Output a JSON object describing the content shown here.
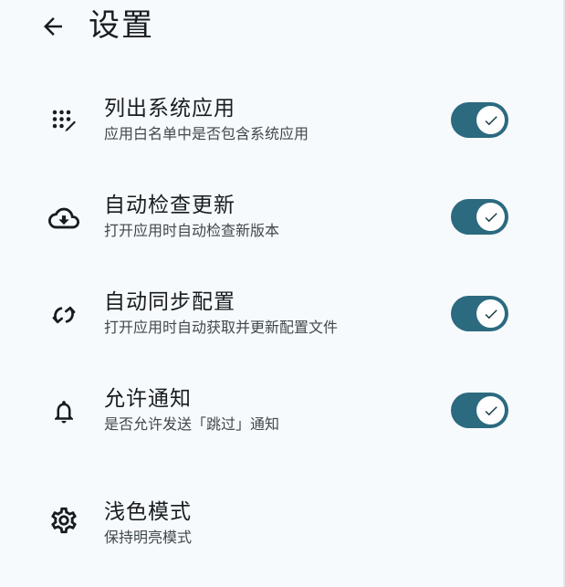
{
  "app_bar": {
    "title": "设置",
    "back_icon": "arrow-back-icon"
  },
  "colors": {
    "background": "#f7fafc",
    "switch_track_on": "#2b6a7f",
    "switch_thumb": "#ffffff",
    "primary_text": "#181c1f",
    "secondary_text": "#40484c"
  },
  "settings": [
    {
      "icon": "apps-edit-icon",
      "title": "列出系统应用",
      "summary": "应用白名单中是否包含系统应用",
      "toggle": true
    },
    {
      "icon": "cloud-download-icon",
      "title": "自动检查更新",
      "summary": "打开应用时自动检查新版本",
      "toggle": true
    },
    {
      "icon": "sync-icon",
      "title": "自动同步配置",
      "summary": "打开应用时自动获取并更新配置文件",
      "toggle": true
    },
    {
      "icon": "bell-icon",
      "title": "允许通知",
      "summary": "是否允许发送「跳过」通知",
      "toggle": true
    },
    {
      "icon": "gear-icon",
      "title": "浅色模式",
      "summary": "保持明亮模式"
    }
  ]
}
